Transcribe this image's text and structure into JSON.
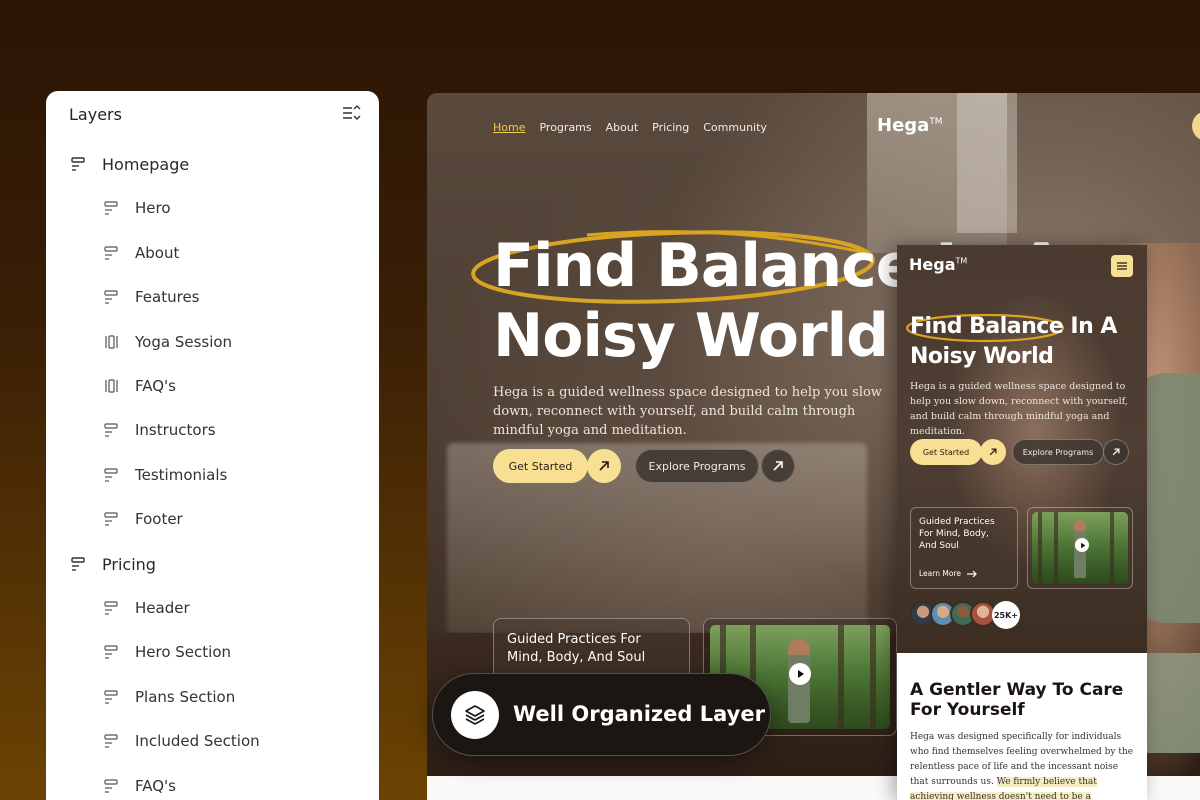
{
  "layers_panel": {
    "title": "Layers",
    "items": [
      {
        "label": "Homepage",
        "level": 0,
        "icon": "frame-icon"
      },
      {
        "label": "Hero",
        "level": 1,
        "icon": "stack-icon"
      },
      {
        "label": "About",
        "level": 1,
        "icon": "stack-icon"
      },
      {
        "label": "Features",
        "level": 1,
        "icon": "stack-icon"
      },
      {
        "label": "Yoga Session",
        "level": 1,
        "icon": "columns-icon"
      },
      {
        "label": "FAQ's",
        "level": 1,
        "icon": "columns-icon"
      },
      {
        "label": "Instructors",
        "level": 1,
        "icon": "stack-icon"
      },
      {
        "label": "Testimonials",
        "level": 1,
        "icon": "stack-icon"
      },
      {
        "label": "Footer",
        "level": 1,
        "icon": "stack-icon"
      },
      {
        "label": "Pricing",
        "level": 0,
        "icon": "frame-icon"
      },
      {
        "label": "Header",
        "level": 1,
        "icon": "stack-icon"
      },
      {
        "label": "Hero Section",
        "level": 1,
        "icon": "stack-icon"
      },
      {
        "label": "Plans Section",
        "level": 1,
        "icon": "stack-icon"
      },
      {
        "label": "Included Section",
        "level": 1,
        "icon": "stack-icon"
      },
      {
        "label": "FAQ's",
        "level": 1,
        "icon": "stack-icon"
      }
    ]
  },
  "desktop": {
    "nav": [
      "Home",
      "Programs",
      "About",
      "Pricing",
      "Community"
    ],
    "active_nav": "Home",
    "logo": "Hega",
    "logo_mark": "TM",
    "headline_line1": "Find Balance In A",
    "headline_line2": "Noisy World",
    "subtext": "Hega is a guided wellness space designed to help you slow down, reconnect with yourself, and build calm through mindful yoga and meditation.",
    "primary_cta": "Get Started",
    "secondary_cta": "Explore Programs",
    "card_title": "Guided Practices For Mind, Body, And Soul"
  },
  "badge": {
    "label": "Well Organized Layer",
    "icon": "layers-icon"
  },
  "mobile": {
    "logo": "Hega",
    "logo_mark": "TM",
    "headline_line1": "Find Balance In A",
    "headline_line2": "Noisy World",
    "subtext": "Hega is a guided wellness space designed to help you slow down, reconnect with yourself, and build calm through mindful yoga and meditation.",
    "primary_cta": "Get Started",
    "secondary_cta": "Explore Programs",
    "card_title": "Guided Practices For Mind, Body, And Soul",
    "card_link": "Learn More",
    "member_count": "25K+",
    "section_title": "A Gentler Way To Care For Yourself",
    "section_text_plain": "Hega was designed specifically for individuals who find themselves feeling overwhelmed by the relentless pace of life and the incessant noise that surrounds us.",
    "section_text_highlight": "We firmly believe that achieving wellness doesn't need to be a strenuous or complex"
  },
  "colors": {
    "accent_yellow": "#f7df93",
    "ring_gold": "#d9a520",
    "active_nav": "#f4c94c",
    "background_top": "#2a1505",
    "background_bottom": "#6b4303"
  }
}
